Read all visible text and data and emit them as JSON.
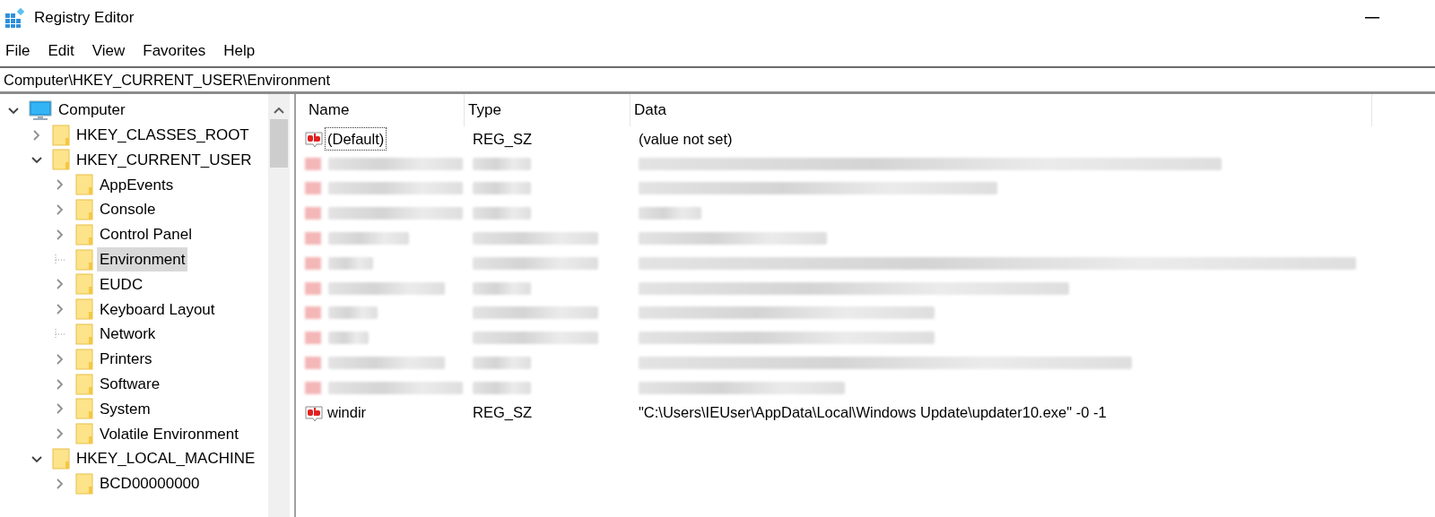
{
  "window": {
    "title": "Registry Editor"
  },
  "menu": [
    "File",
    "Edit",
    "View",
    "Favorites",
    "Help"
  ],
  "address": "Computer\\HKEY_CURRENT_USER\\Environment",
  "tree": [
    {
      "label": "Computer",
      "kind": "computer",
      "expandable": true,
      "expanded": true,
      "selected": false,
      "children": [
        {
          "label": "HKEY_CLASSES_ROOT",
          "expandable": true,
          "expanded": false,
          "selected": false
        },
        {
          "label": "HKEY_CURRENT_USER",
          "expandable": true,
          "expanded": true,
          "selected": false,
          "children": [
            {
              "label": "AppEvents",
              "expandable": true,
              "expanded": false,
              "selected": false
            },
            {
              "label": "Console",
              "expandable": true,
              "expanded": false,
              "selected": false
            },
            {
              "label": "Control Panel",
              "expandable": true,
              "expanded": false,
              "selected": false
            },
            {
              "label": "Environment",
              "expandable": false,
              "selected": true
            },
            {
              "label": "EUDC",
              "expandable": true,
              "expanded": false,
              "selected": false
            },
            {
              "label": "Keyboard Layout",
              "expandable": true,
              "expanded": false,
              "selected": false
            },
            {
              "label": "Network",
              "expandable": false,
              "selected": false
            },
            {
              "label": "Printers",
              "expandable": true,
              "expanded": false,
              "selected": false
            },
            {
              "label": "Software",
              "expandable": true,
              "expanded": false,
              "selected": false
            },
            {
              "label": "System",
              "expandable": true,
              "expanded": false,
              "selected": false
            },
            {
              "label": "Volatile Environment",
              "expandable": true,
              "expanded": false,
              "selected": false
            }
          ]
        },
        {
          "label": "HKEY_LOCAL_MACHINE",
          "expandable": true,
          "expanded": true,
          "selected": false,
          "children": [
            {
              "label": "BCD00000000",
              "expandable": true,
              "expanded": false,
              "selected": false
            }
          ]
        }
      ]
    }
  ],
  "table": {
    "columns": [
      "Name",
      "Type",
      "Data"
    ],
    "rows": [
      {
        "kind": "value",
        "focused": true,
        "name": "(Default)",
        "type": "REG_SZ",
        "data": "(value not set)"
      },
      {
        "kind": "blurred"
      },
      {
        "kind": "blurred"
      },
      {
        "kind": "blurred"
      },
      {
        "kind": "blurred"
      },
      {
        "kind": "blurred"
      },
      {
        "kind": "blurred"
      },
      {
        "kind": "blurred"
      },
      {
        "kind": "blurred"
      },
      {
        "kind": "blurred"
      },
      {
        "kind": "blurred"
      },
      {
        "kind": "value",
        "focused": false,
        "name": "windir",
        "type": "REG_SZ",
        "data": "\"C:\\Users\\IEUser\\AppData\\Local\\Windows Update\\updater10.exe\" -0 -1"
      }
    ]
  }
}
